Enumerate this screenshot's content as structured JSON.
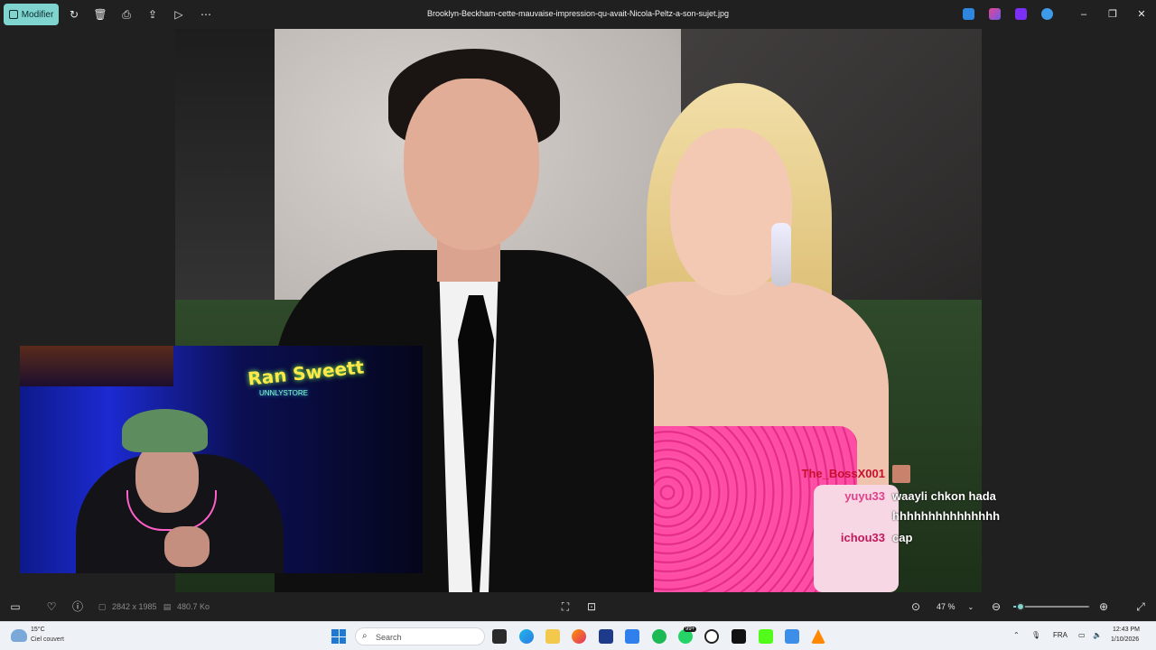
{
  "titlebar": {
    "modify_label": "Modifier",
    "file_name": "Brooklyn-Beckham-cette-mauvaise-impression-qu-avait-Nicola-Peltz-a-son-sujet.jpg",
    "icons": [
      "rotate-icon",
      "delete-icon",
      "print-icon",
      "share-icon",
      "slideshow-icon",
      "more-icon"
    ],
    "window_controls": {
      "minimize": "–",
      "restore": "❐",
      "close": "✕"
    }
  },
  "stream": {
    "sign_text": "Ran Sweett",
    "sign_sub": "UNNLYSTORE"
  },
  "chat": [
    {
      "user": "The_BossX001",
      "message": "",
      "color": "#c8102e"
    },
    {
      "user": "yuyu33",
      "message": "waayli chkon hada",
      "color": "#e0428a"
    },
    {
      "user": "",
      "message": "hhhhhhhhhhhhhhh",
      "color": "#ffffff"
    },
    {
      "user": "ichou33",
      "message": "cap",
      "color": "#c2185b"
    }
  ],
  "bottombar": {
    "dimensions": "2842 x 1985",
    "file_size": "480.7 Ko",
    "zoom": "47 %",
    "zoom_fraction": 0.1
  },
  "taskbar": {
    "weather_temp": "15°C",
    "weather_desc": "Ciel couvert",
    "search_placeholder": "Search",
    "badge": "99+",
    "lang": "FRA",
    "time": "12:43 PM",
    "date": "1/10/2026"
  },
  "colors": {
    "accent": "#7fd4d0",
    "background": "#202020"
  }
}
